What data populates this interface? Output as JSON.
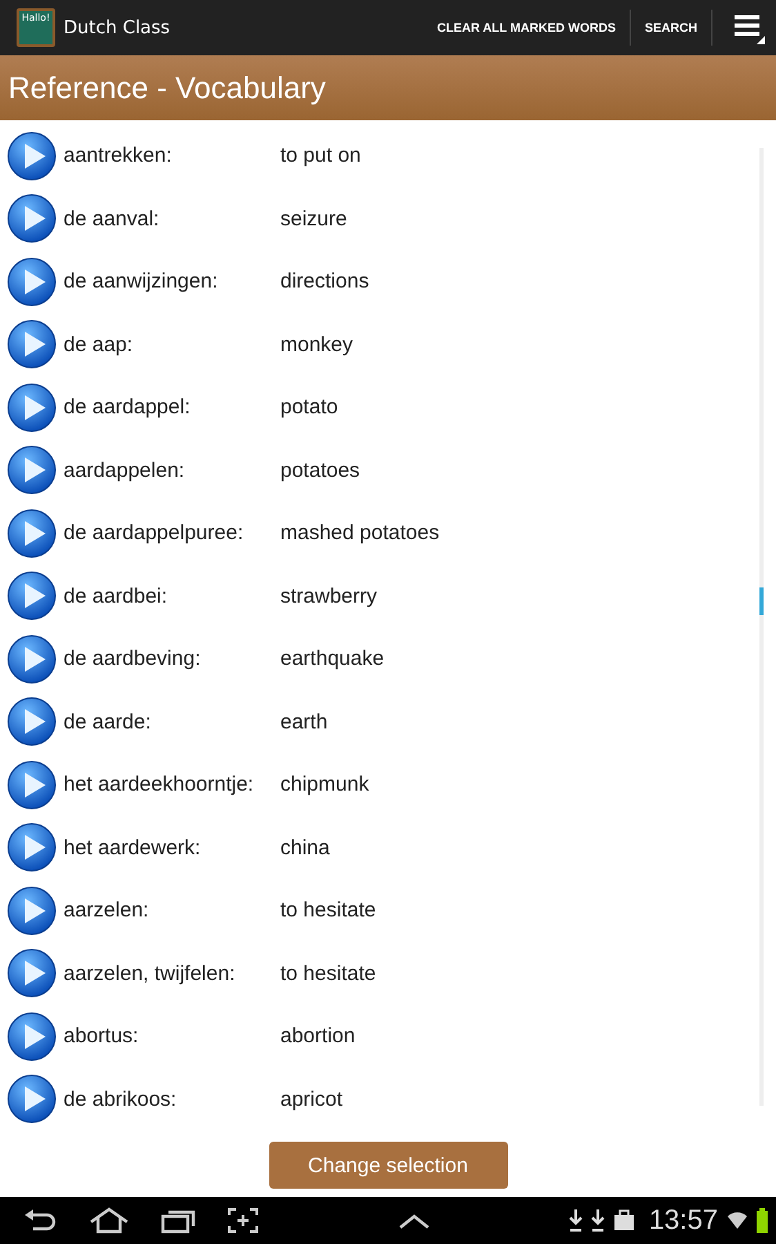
{
  "action_bar": {
    "title": "Dutch Class",
    "logo_text": "Hallo!",
    "actions": [
      "CLEAR ALL MARKED WORDS",
      "SEARCH"
    ]
  },
  "header": {
    "title": "Reference - Vocabulary"
  },
  "words": [
    {
      "dutch": "aantrekken:",
      "english": "to put on"
    },
    {
      "dutch": "de aanval:",
      "english": "seizure"
    },
    {
      "dutch": "de aanwijzingen:",
      "english": "directions"
    },
    {
      "dutch": "de aap:",
      "english": "monkey"
    },
    {
      "dutch": "de aardappel:",
      "english": "potato"
    },
    {
      "dutch": "aardappelen:",
      "english": "potatoes"
    },
    {
      "dutch": "de aardappelpuree:",
      "english": "mashed potatoes"
    },
    {
      "dutch": "de aardbei:",
      "english": "strawberry"
    },
    {
      "dutch": "de aardbeving:",
      "english": "earthquake"
    },
    {
      "dutch": "de aarde:",
      "english": "earth"
    },
    {
      "dutch": "het aardeekhoorntje:",
      "english": "chipmunk"
    },
    {
      "dutch": "het aardewerk:",
      "english": "china"
    },
    {
      "dutch": "aarzelen:",
      "english": "to hesitate"
    },
    {
      "dutch": "aarzelen, twijfelen:",
      "english": "to hesitate"
    },
    {
      "dutch": "abortus:",
      "english": "abortion"
    },
    {
      "dutch": "de abrikoos:",
      "english": "apricot"
    }
  ],
  "footer_button": "Change selection",
  "status_bar": {
    "time": "13:57"
  }
}
